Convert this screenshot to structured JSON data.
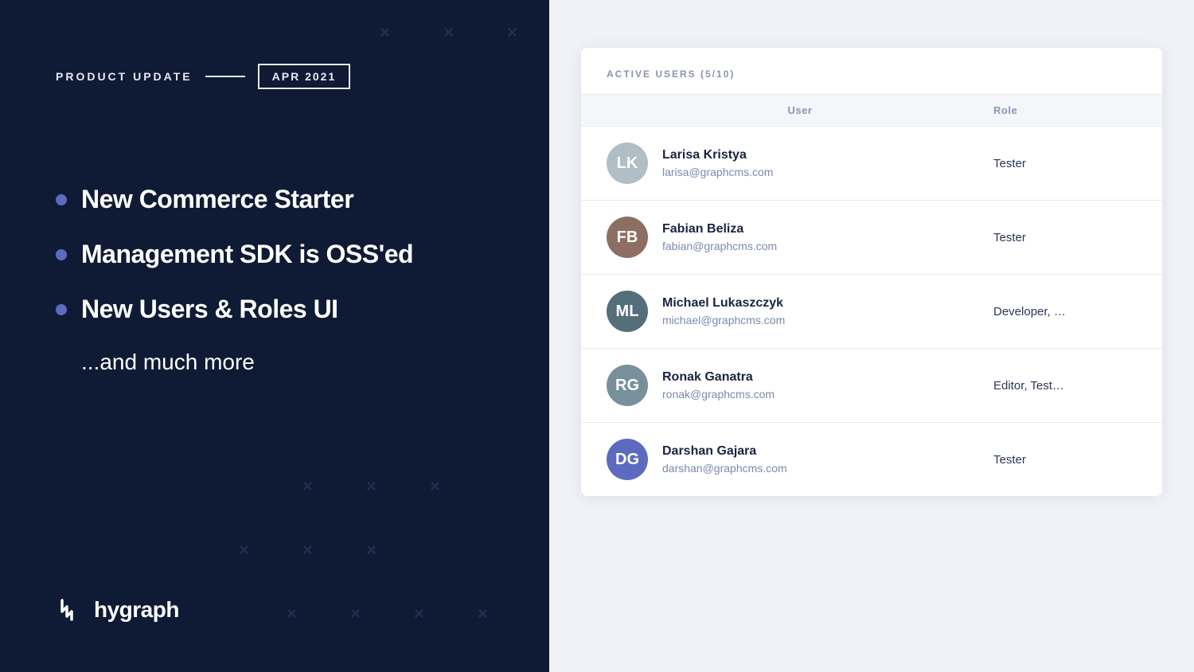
{
  "left": {
    "product_update_label": "PRODUCT UPDATE",
    "product_update_date": "APR 2021",
    "features": [
      {
        "text": "New Commerce Starter"
      },
      {
        "text": "Management SDK is OSS'ed"
      },
      {
        "text": "New Users & Roles UI"
      }
    ],
    "more_text": "...and much more",
    "logo_text": "hygraph"
  },
  "right": {
    "section_title": "ACTIVE USERS (5/10)",
    "table": {
      "col_user": "User",
      "col_role": "Role",
      "rows": [
        {
          "name": "Larisa Kristya",
          "email": "larisa@graphcms.com",
          "role": "Tester",
          "initials": "LK",
          "avatar_class": "avatar-1"
        },
        {
          "name": "Fabian Beliza",
          "email": "fabian@graphcms.com",
          "role": "Tester",
          "initials": "FB",
          "avatar_class": "avatar-2"
        },
        {
          "name": "Michael Lukaszczyk",
          "email": "michael@graphcms.com",
          "role": "Developer, …",
          "initials": "ML",
          "avatar_class": "avatar-3"
        },
        {
          "name": "Ronak Ganatra",
          "email": "ronak@graphcms.com",
          "role": "Editor, Test…",
          "initials": "RG",
          "avatar_class": "avatar-4"
        },
        {
          "name": "Darshan Gajara",
          "email": "darshan@graphcms.com",
          "role": "Tester",
          "initials": "DG",
          "avatar_class": "avatar-5"
        }
      ]
    }
  },
  "decorations": {
    "x_char": "×"
  }
}
